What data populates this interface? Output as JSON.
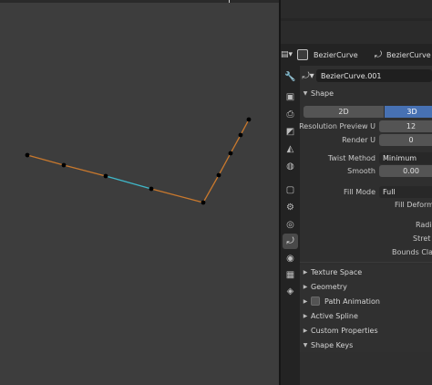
{
  "viewport": {
    "name": "3D Viewport"
  },
  "header": {
    "object_name": "BezierCurve",
    "data_name": "BezierCurve"
  },
  "datablock": {
    "name": "BezierCurve.001"
  },
  "shape": {
    "title": "Shape",
    "mode_2d": "2D",
    "mode_3d": "3D",
    "resolution_preview_u": {
      "label": "Resolution Preview U",
      "value": "12"
    },
    "render_u": {
      "label": "Render U",
      "value": "0"
    },
    "twist_method": {
      "label": "Twist Method",
      "value": "Minimum"
    },
    "smooth": {
      "label": "Smooth",
      "value": "0.00"
    },
    "fill_mode": {
      "label": "Fill Mode",
      "value": "Full"
    },
    "fill_deform": "Fill Deforme",
    "radius": "Radi",
    "stretch": "Stret",
    "bounds_clamp": "Bounds Clan"
  },
  "sections": [
    {
      "label": "Texture Space",
      "expanded": false
    },
    {
      "label": "Geometry",
      "expanded": false
    },
    {
      "label": "Path Animation",
      "expanded": false,
      "checkbox": true
    },
    {
      "label": "Active Spline",
      "expanded": false
    },
    {
      "label": "Custom Properties",
      "expanded": false
    },
    {
      "label": "Shape Keys",
      "expanded": true
    }
  ],
  "curve_colors": {
    "segment": "#c8782d",
    "active_segment": "#3fb7c8",
    "point": "#000000",
    "background": "#3d3d3d"
  },
  "tabs": [
    "tool-icon",
    "render-icon",
    "output-icon",
    "view-layer-icon",
    "scene-icon",
    "world-icon",
    "object-icon",
    "modifier-icon",
    "physics-icon",
    "constraint-icon",
    "curve-data-icon",
    "material-icon",
    "texture-icon",
    "particles-icon"
  ]
}
